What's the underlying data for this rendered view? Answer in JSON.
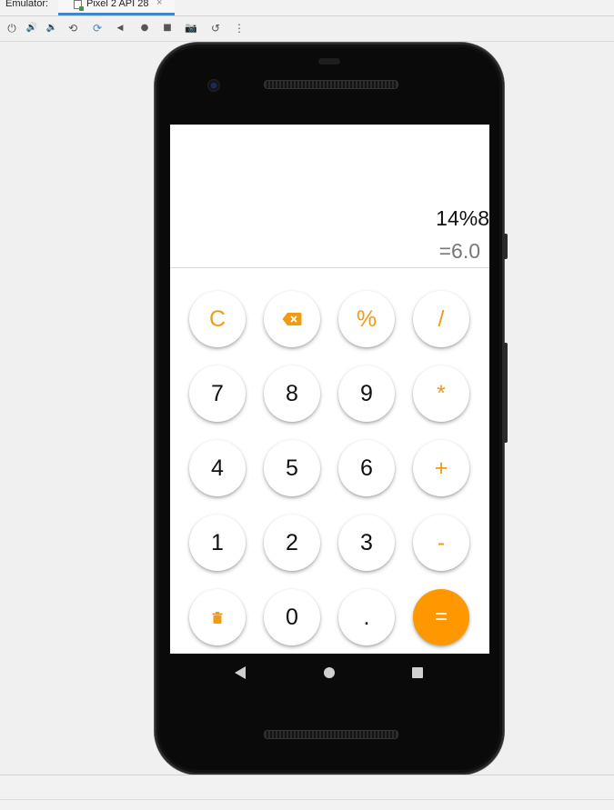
{
  "ide": {
    "panel_label": "Emulator:",
    "tab_title": "Pixel 2 API 28",
    "tab_close": "×"
  },
  "toolbar": {
    "icons": [
      "power-icon",
      "volume-up-icon",
      "volume-down-icon",
      "rotate-left-icon",
      "rotate-right-icon",
      "back-icon",
      "home-icon",
      "overview-icon",
      "screenshot-icon",
      "reset-icon",
      "more-icon"
    ],
    "glyphs": {
      "power": "⏻",
      "vol_up": "🔊",
      "vol_down": "🔉",
      "rotate_left": "⟲",
      "rotate_right": "⟳",
      "back": "◀",
      "home": "●",
      "overview": "■",
      "screenshot": "📷",
      "reset": "↺",
      "more": "⋮"
    }
  },
  "display": {
    "expression": "14%8",
    "result": "=6.0"
  },
  "keys": {
    "clear": "C",
    "backspace": "⌫",
    "percent": "%",
    "divide": "/",
    "seven": "7",
    "eight": "8",
    "nine": "9",
    "multiply": "*",
    "four": "4",
    "five": "5",
    "six": "6",
    "plus": "+",
    "one": "1",
    "two": "2",
    "three": "3",
    "minus": "-",
    "delete": "🗑",
    "zero": "0",
    "dot": ".",
    "equals": "="
  },
  "colors": {
    "accent": "#ff9800",
    "operator_text": "#f39a13",
    "result_text": "#777777"
  }
}
